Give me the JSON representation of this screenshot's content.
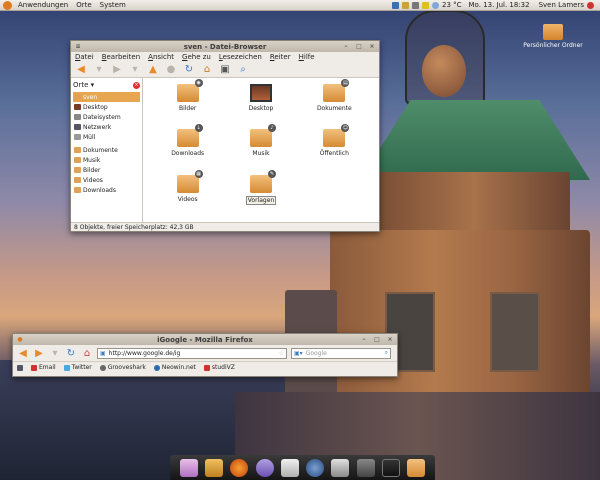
{
  "top_panel": {
    "menus": [
      "Anwendungen",
      "Orte",
      "System"
    ],
    "temperature": "23 °C",
    "datetime": "Mo. 13. Jul. 18:32",
    "user": "Sven Lamers"
  },
  "desktop": {
    "icon_label": "Persönlicher Ordner"
  },
  "file_browser": {
    "title": "sven - Datei-Browser",
    "menus": [
      "Datei",
      "Bearbeiten",
      "Ansicht",
      "Gehe zu",
      "Lesezeichen",
      "Reiter",
      "Hilfe"
    ],
    "sidebar_header": "Orte",
    "places": [
      "sven",
      "Desktop",
      "Dateisystem",
      "Netzwerk",
      "Müll"
    ],
    "bookmarks": [
      "Dokumente",
      "Musik",
      "Bilder",
      "Videos",
      "Downloads"
    ],
    "items": [
      {
        "label": "Bilder",
        "icon": "folder-icon",
        "emblem": "camera-emblem-icon"
      },
      {
        "label": "Desktop",
        "icon": "desktop-folder-icon",
        "emblem": ""
      },
      {
        "label": "Dokumente",
        "icon": "folder-icon",
        "emblem": "document-emblem-icon"
      },
      {
        "label": "Downloads",
        "icon": "folder-icon",
        "emblem": "download-emblem-icon"
      },
      {
        "label": "Musik",
        "icon": "folder-icon",
        "emblem": "music-emblem-icon"
      },
      {
        "label": "Öffentlich",
        "icon": "folder-icon",
        "emblem": "person-emblem-icon"
      },
      {
        "label": "Videos",
        "icon": "folder-icon",
        "emblem": "film-emblem-icon"
      },
      {
        "label": "Vorlagen",
        "icon": "folder-icon",
        "emblem": "template-emblem-icon"
      }
    ],
    "status": "8 Objekte, freier Speicherplatz: 42,3 GB"
  },
  "firefox": {
    "title": "iGoogle - Mozilla Firefox",
    "url": "http://www.google.de/ig",
    "search_placeholder": "Google",
    "bookmarks": [
      "Email",
      "Twitter",
      "Grooveshark",
      "Neowin.net",
      "studiVZ"
    ]
  },
  "colors": {
    "accent": "#e88a2a",
    "selection": "#e7a650",
    "panel": "#e4dfd7"
  }
}
